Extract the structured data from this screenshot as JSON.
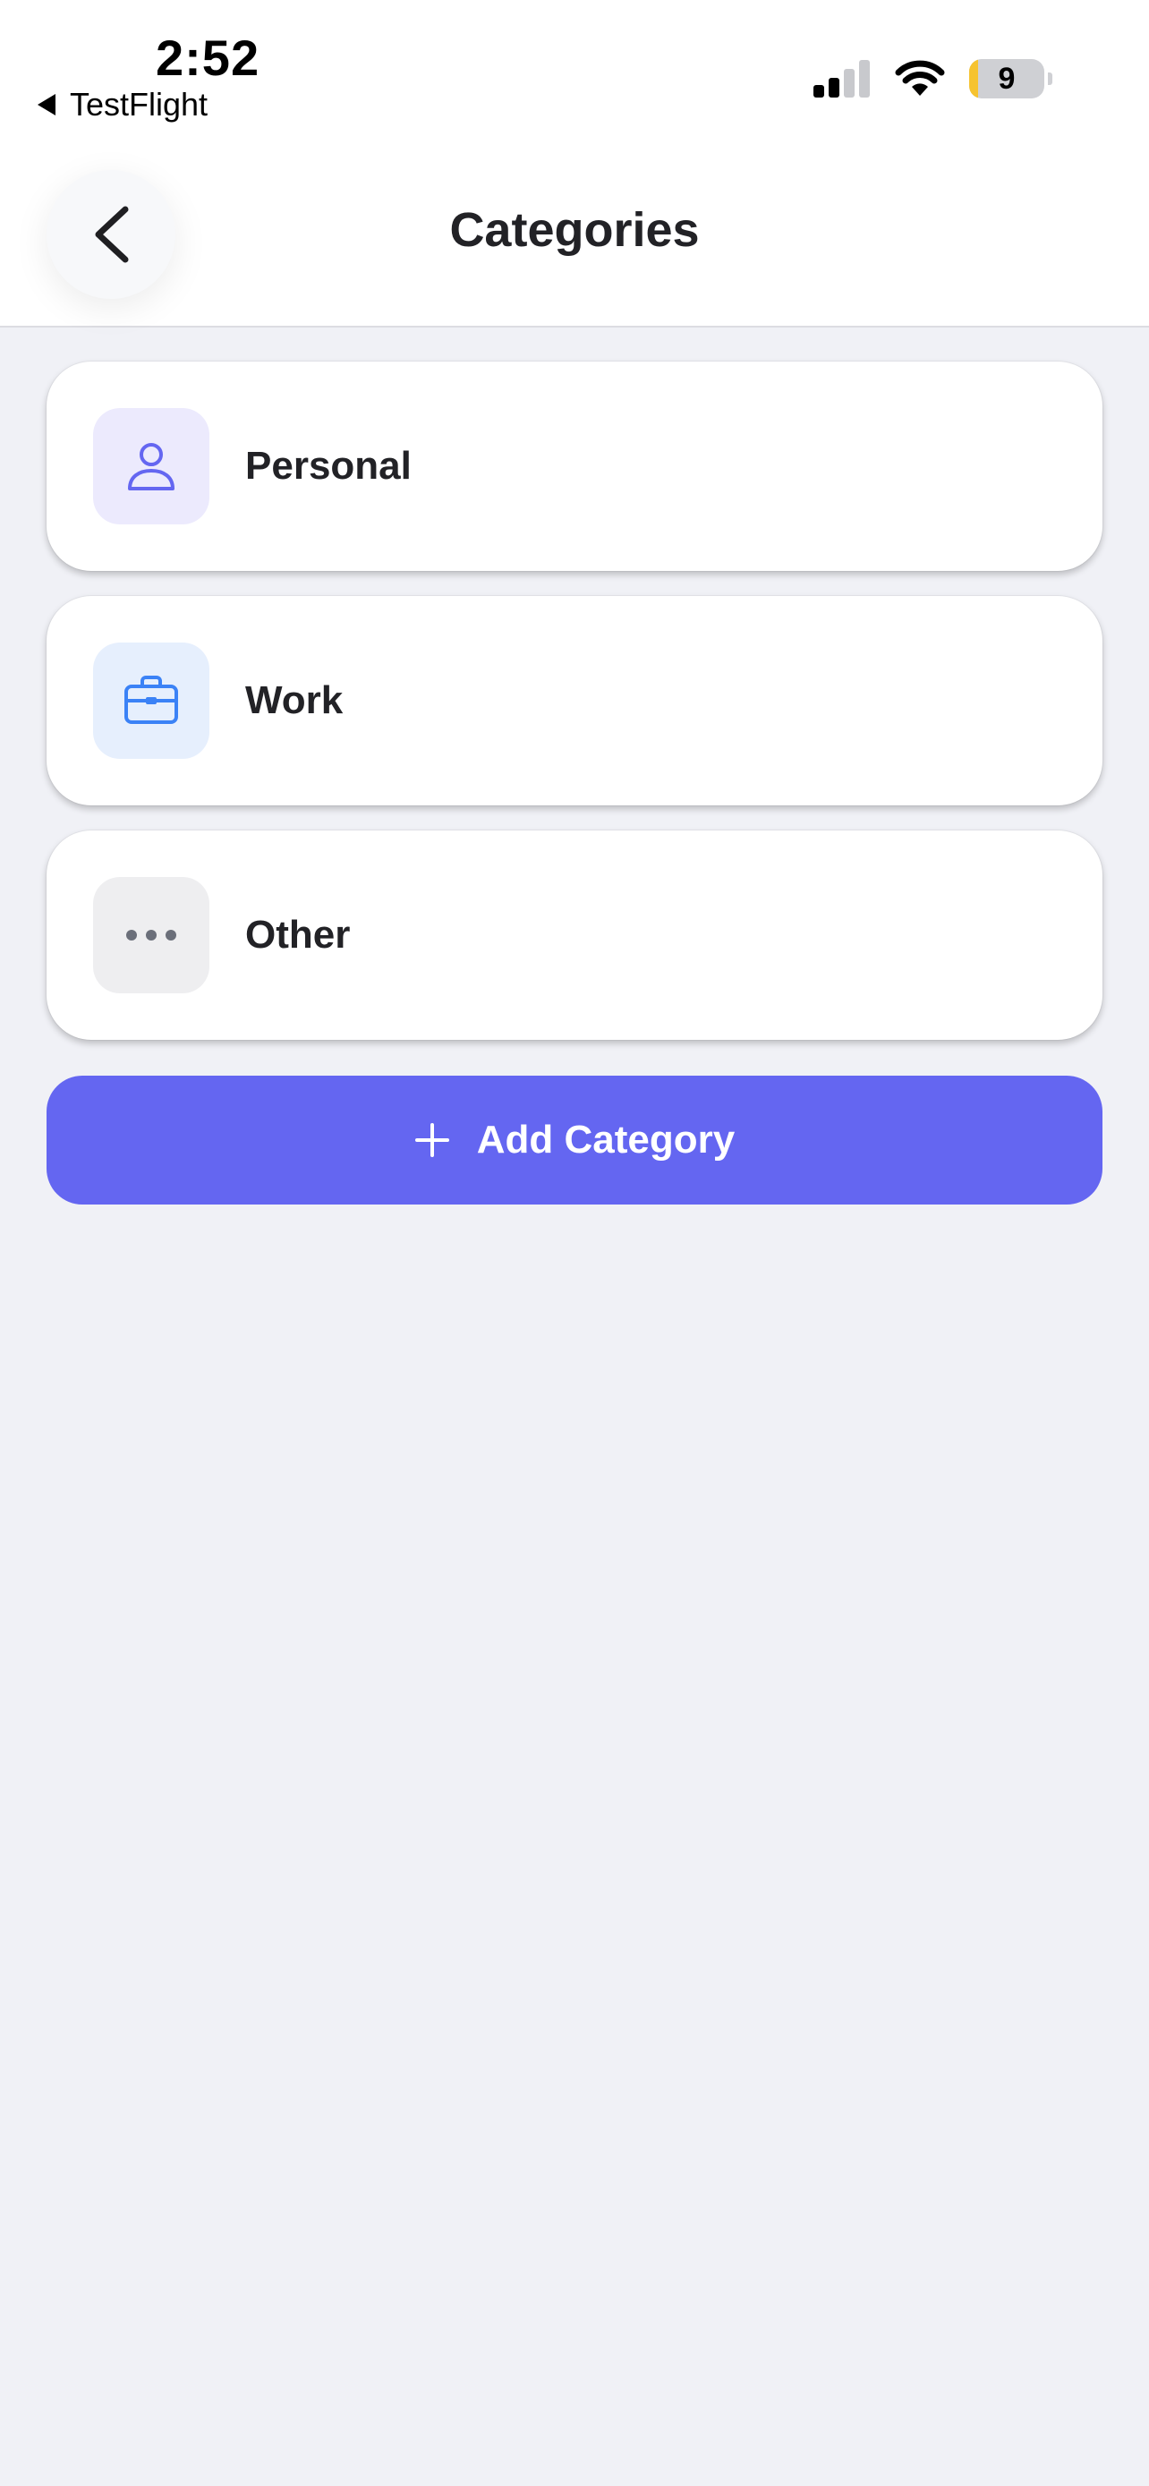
{
  "status_bar": {
    "time": "2:52",
    "back_app": "TestFlight",
    "battery": "9",
    "battery_level": 0.09
  },
  "header": {
    "title": "Categories"
  },
  "categories": [
    {
      "label": "Personal",
      "icon": "person-icon",
      "icon_color": "#6466f1",
      "tile_color": "#eceafd"
    },
    {
      "label": "Work",
      "icon": "briefcase-icon",
      "icon_color": "#3b82f6",
      "tile_color": "#e6effd"
    },
    {
      "label": "Other",
      "icon": "more-icon",
      "icon_color": "#6b6f7a",
      "tile_color": "#eeeef0"
    }
  ],
  "add_button": {
    "label": "Add Category",
    "color": "#6466f1"
  }
}
